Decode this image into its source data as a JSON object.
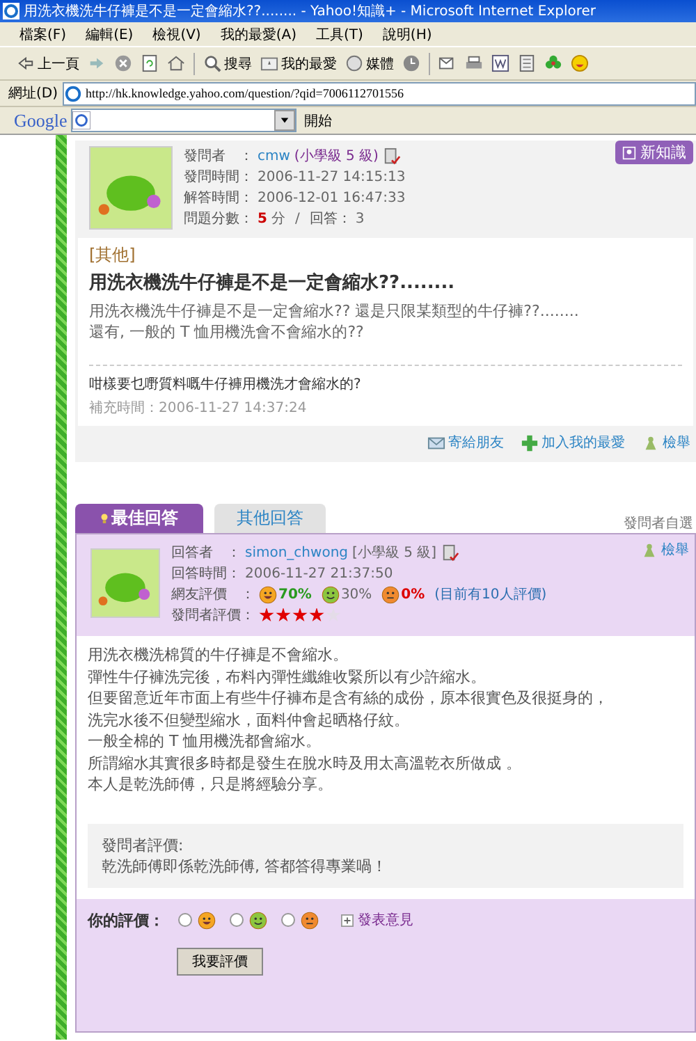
{
  "window": {
    "title": "用洗衣機洗牛仔褲是不是一定會縮水??........ - Yahoo!知識+ - Microsoft Internet Explorer"
  },
  "menu_bar": [
    "檔案(F)",
    "編輯(E)",
    "檢視(V)",
    "我的最愛(A)",
    "工具(T)",
    "說明(H)"
  ],
  "toolbar": {
    "back": "上一頁",
    "search": "搜尋",
    "favorites": "我的最愛",
    "media": "媒體"
  },
  "address_bar": {
    "label": "網址(D)",
    "url": "http://hk.knowledge.yahoo.com/question/?qid=7006112701556"
  },
  "google_bar": {
    "logo": "Google",
    "go_button": "開始"
  },
  "question": {
    "new_button": "新知識",
    "asker_label": "發問者　：",
    "asker": "cmw",
    "asker_level": "(小學級 5 級)",
    "ask_time_label": "發問時間：",
    "ask_time": "2006-11-27 14:15:13",
    "answer_time_label": "解答時間：",
    "answer_time": "2006-12-01 16:47:33",
    "score_label": "問題分數：",
    "score": "5",
    "score_unit": "分",
    "separator": "/",
    "answers_label": "回答：",
    "answers": "3",
    "category": "[其他]",
    "title": "用洗衣機洗牛仔褲是不是一定會縮水??........",
    "body": [
      "用洗衣機洗牛仔褲是不是一定會縮水?? 還是只限某類型的牛仔褲??........",
      "還有, 一般的 T 恤用機洗會不會縮水的??"
    ],
    "supplement": "咁樣要乜嘢質料嘅牛仔褲用機洗才會縮水的?",
    "supplement_time_label": "補充時間：",
    "supplement_time": "2006-11-27 14:37:24",
    "actions": [
      {
        "kind": "mail",
        "label": "寄給朋友"
      },
      {
        "kind": "add",
        "label": "加入我的最愛"
      },
      {
        "kind": "report",
        "label": "檢舉"
      }
    ]
  },
  "tabs": [
    {
      "label": "最佳回答",
      "selected": true
    },
    {
      "label": "其他回答",
      "selected": false
    }
  ],
  "self_chosen": "發問者自選",
  "answer": {
    "report": "檢舉",
    "answerer_label": "回答者　：",
    "answerer": "simon_chwong",
    "answerer_level": "[小學級 5 級]",
    "time_label": "回答時間：",
    "time": "2006-11-27 21:37:50",
    "votes_label": "網友評價　：",
    "votes": [
      {
        "kind": "good",
        "percent": "70%"
      },
      {
        "kind": "ok",
        "percent": "30%"
      },
      {
        "kind": "bad",
        "percent": "0%"
      }
    ],
    "votes_count": "(目前有10人評價)",
    "asker_rating_label": "發問者評價：",
    "stars": 4,
    "body": [
      "用洗衣機洗棉質的牛仔褲是不會縮水。",
      "彈性牛仔褲洗完後，布料內彈性纖維收緊所以有少許縮水。",
      "但要留意近年市面上有些牛仔褲布是含有絲的成份，原本很實色及很挺身的，",
      "洗完水後不但變型縮水，面料仲會起晒格仔紋。",
      "一般全棉的 T 恤用機洗都會縮水。",
      "所謂縮水其實很多時都是發生在脫水時及用太高溫乾衣所做成 。",
      "本人是乾洗師傅，只是將經驗分享。"
    ],
    "comment_label": "發問者評價:",
    "comment": "乾洗師傅即係乾洗師傅, 答都答得專業喎！"
  },
  "your_rating": {
    "label": "你的評價：",
    "options": [
      {
        "kind": "good",
        "selected": false
      },
      {
        "kind": "ok",
        "selected": false
      },
      {
        "kind": "bad",
        "selected": false
      }
    ],
    "comment_link": "發表意見",
    "submit": "我要評價"
  }
}
